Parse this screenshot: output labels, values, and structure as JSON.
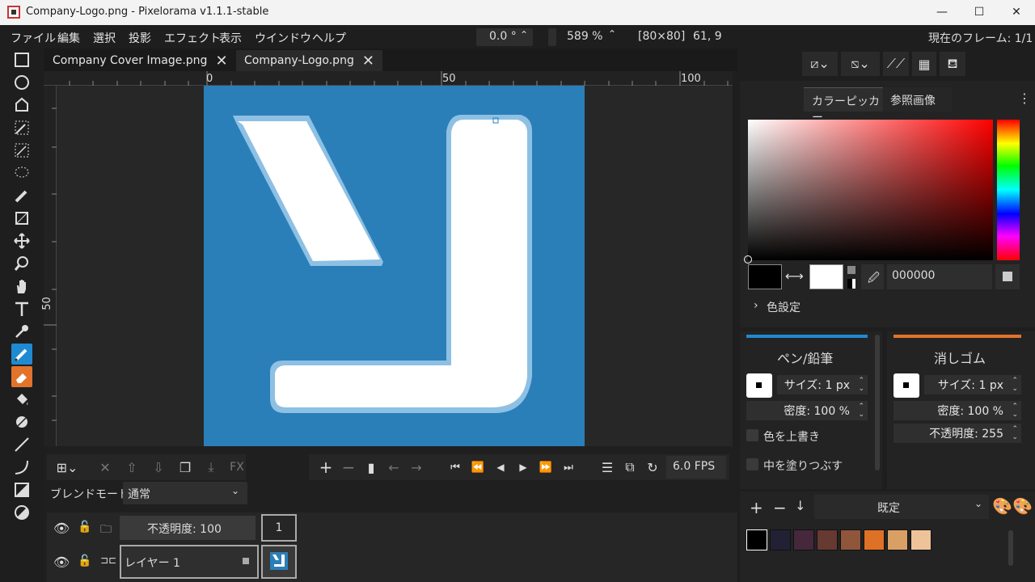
{
  "window": {
    "title": "Company-Logo.png - Pixelorama v1.1.1-stable",
    "minimize": "—",
    "maximize": "☐",
    "close": "✕"
  },
  "menu": [
    "ファイル",
    "編集",
    "選択",
    "投影",
    "エフェクト",
    "表示",
    "ウインドウ",
    "ヘルプ"
  ],
  "status": {
    "rotation": "0.0 °",
    "zoom": "589 %",
    "canvas_size": "[80×80]",
    "cursor_pos": "61, 9",
    "current_frame": "現在のフレーム: 1/1"
  },
  "tabs": [
    {
      "label": "Company Cover Image.png",
      "active": false
    },
    {
      "label": "Company-Logo.png",
      "active": true
    }
  ],
  "ruler": {
    "h0": "0",
    "h50": "50",
    "h100": "100",
    "v50": "50"
  },
  "canvas": {
    "bg_color": "#2a7fb8",
    "logo_color": "#ffffff"
  },
  "timeline": {
    "blend_mode_label": "ブレンドモード:",
    "blend_mode_value": "通常",
    "fx_label": "FX",
    "fps": "6.0 FPS",
    "layer_opacity": "不透明度: 100",
    "frame_number": "1",
    "layer_name": "レイヤー 1"
  },
  "right": {
    "tabs": [
      "カラーピッカー",
      "参照画像"
    ],
    "hex_value": "000000",
    "color_settings": "色設定",
    "primary_color": "#000000",
    "secondary_color": "#ffffff"
  },
  "pen": {
    "title": "ペン/鉛筆",
    "size": "サイズ: 1 px",
    "density": "密度: 100 %",
    "overwrite": "色を上書き",
    "fill_inside": "中を塗りつぶす",
    "accent": "#1f8ad2"
  },
  "eraser": {
    "title": "消しゴム",
    "size": "サイズ: 1 px",
    "density": "密度: 100 %",
    "opacity": "不透明度: 255",
    "accent": "#e2732b"
  },
  "palette": {
    "name": "既定",
    "colors": [
      "#000000",
      "#222034",
      "#45283c",
      "#663931",
      "#8f563b",
      "#df7126",
      "#d9a066",
      "#eec39a"
    ]
  }
}
